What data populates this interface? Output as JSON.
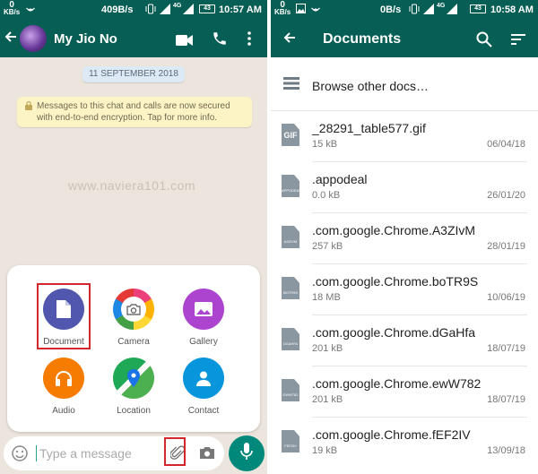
{
  "colors": {
    "primary": "#075e54",
    "chat_bg": "#ece5dd",
    "accent": "#00897b",
    "highlight": "#d6262d"
  },
  "left": {
    "status": {
      "net_value": "0",
      "net_unit": "KB/s",
      "speed": "409B/s",
      "battery": "43",
      "time": "10:57 AM",
      "network": "4G"
    },
    "chat": {
      "title": "My Jio No",
      "date_chip": "11 SEPTEMBER 2018",
      "encryption_notice": "Messages to this chat and calls are now secured with end-to-end encryption. Tap for more info.",
      "watermark": "www.naviera101.com"
    },
    "attach": [
      {
        "label": "Document",
        "icon": "document-icon"
      },
      {
        "label": "Camera",
        "icon": "camera-icon"
      },
      {
        "label": "Gallery",
        "icon": "gallery-icon"
      },
      {
        "label": "Audio",
        "icon": "headphones-icon"
      },
      {
        "label": "Location",
        "icon": "location-pin-icon"
      },
      {
        "label": "Contact",
        "icon": "person-icon"
      }
    ],
    "input": {
      "placeholder": "Type a message"
    }
  },
  "right": {
    "status": {
      "net_value": "0",
      "net_unit": "KB/s",
      "speed": "0B/s",
      "battery": "43",
      "time": "10:58 AM",
      "network": "4G"
    },
    "title": "Documents",
    "browse_label": "Browse other docs…",
    "files": [
      {
        "name": "_28291_table577.gif",
        "size": "15 kB",
        "date": "06/04/18",
        "icon_text": "GIF"
      },
      {
        "name": ".appodeal",
        "size": "0.0 kB",
        "date": "26/01/20",
        "icon_text": "APPODEAL"
      },
      {
        "name": ".com.google.Chrome.A3ZIvM",
        "size": "257 kB",
        "date": "28/01/19",
        "icon_text": "A3ZIVM"
      },
      {
        "name": ".com.google.Chrome.boTR9S",
        "size": "18 MB",
        "date": "10/06/19",
        "icon_text": "BOTR9S"
      },
      {
        "name": ".com.google.Chrome.dGaHfa",
        "size": "201 kB",
        "date": "18/07/19",
        "icon_text": "DGAHFA"
      },
      {
        "name": ".com.google.Chrome.ewW782",
        "size": "201 kB",
        "date": "18/07/19",
        "icon_text": "EWW782"
      },
      {
        "name": ".com.google.Chrome.fEF2IV",
        "size": "19 kB",
        "date": "13/09/18",
        "icon_text": "FEF2IV"
      }
    ]
  }
}
